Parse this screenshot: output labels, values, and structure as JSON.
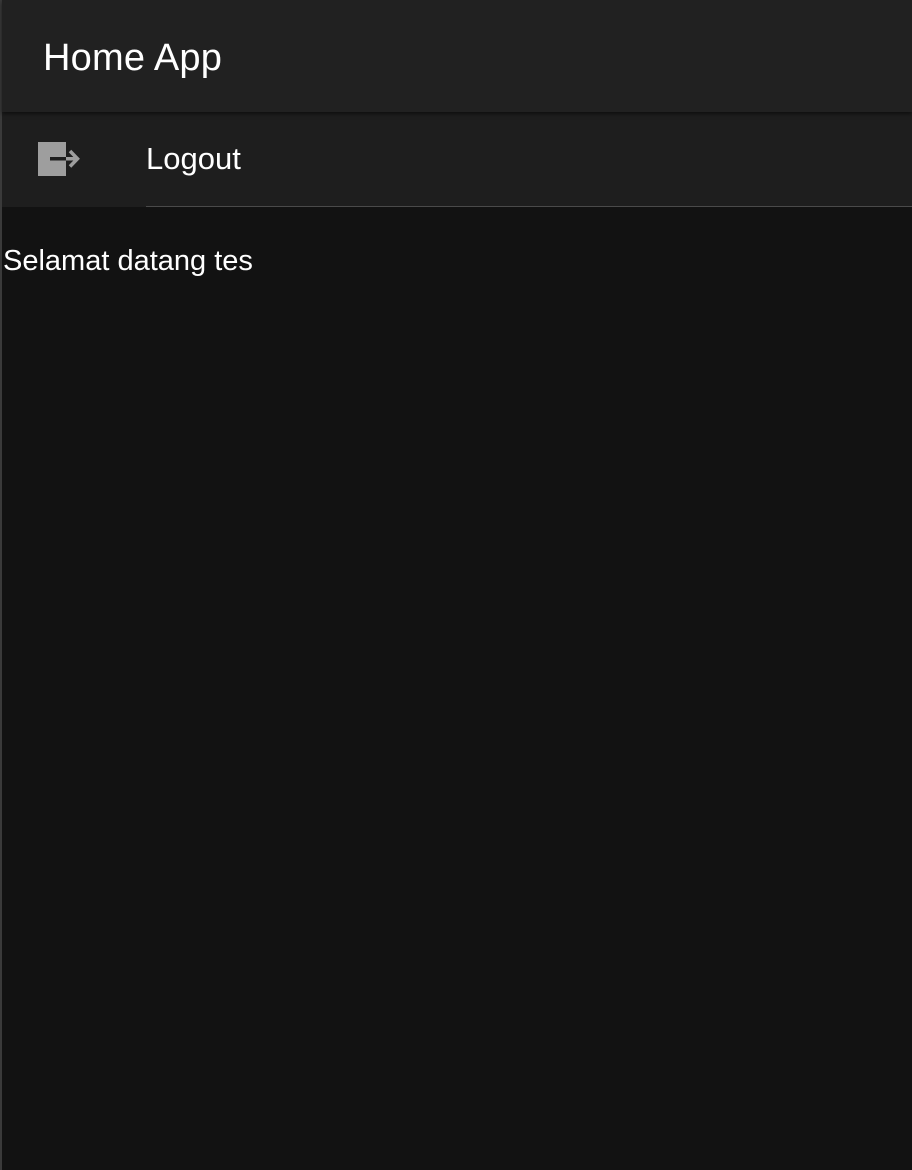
{
  "app_bar": {
    "title": "Home App"
  },
  "menu": {
    "logout": {
      "label": "Logout",
      "icon": "logout-icon"
    }
  },
  "body": {
    "welcome": "Selamat datang tes"
  },
  "colors": {
    "app_bar_background": "#212121",
    "tile_background": "#1e1e1e",
    "page_background": "#121212",
    "icon_gray": "#9e9e9e",
    "text": "#ffffff"
  }
}
